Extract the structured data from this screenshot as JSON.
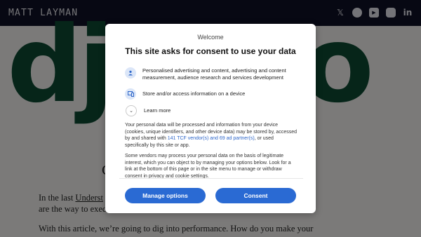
{
  "header": {
    "brand": "MATT LAYMAN",
    "social": [
      "X",
      "GitHub",
      "YouTube",
      "Discord",
      "LinkedIn"
    ]
  },
  "hero": {
    "left_text": "dj",
    "right_text": "o"
  },
  "article": {
    "heading_fragment": "C",
    "p1_prefix": "In the last ",
    "p1_link": "Underst",
    "p1_line2": "are the way to execu",
    "p2_line1": "With this article, we’re going to dig into performance. How do you make your"
  },
  "dialog": {
    "welcome": "Welcome",
    "title": "This site asks for consent to use your data",
    "purposes": [
      {
        "icon": "person-icon",
        "text": "Personalised advertising and content, advertising and content measurement, audience research and services development"
      },
      {
        "icon": "device-icon",
        "text": "Store and/or access information on a device"
      }
    ],
    "learn_more": "Learn more",
    "body1_pre": "Your personal data will be processed and information from your device (cookies, unique identifiers, and other device data) may be stored by, accessed by and shared with ",
    "body1_link": "141 TCF vendor(s) and 69 ad partner(s)",
    "body1_post": ", or used specifically by this site or app.",
    "body2": "Some vendors may process your personal data on the basis of legitimate interest, which you can object to by managing your options below. Look for a link at the bottom of this page or in the site menu to manage or withdraw consent in privacy and cookie settings.",
    "manage_label": "Manage options",
    "consent_label": "Consent"
  },
  "colors": {
    "header_bg": "#0f1126",
    "hero_green": "#0c4b33",
    "button_blue": "#2a6ad3",
    "link_blue": "#2f67c9"
  }
}
